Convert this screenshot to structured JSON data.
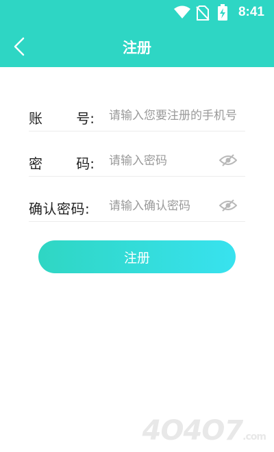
{
  "status_bar": {
    "time": "8:41",
    "icons": [
      "wifi-icon",
      "no-sim-icon",
      "battery-charging-icon"
    ]
  },
  "header": {
    "title": "注册",
    "back_icon": "chevron-left-icon",
    "color": "#2ed6c4"
  },
  "form": {
    "phone": {
      "label_left": "账",
      "label_right": "号:",
      "placeholder": "请输入您要注册的手机号"
    },
    "password": {
      "label_left": "密",
      "label_right": "码:",
      "placeholder": "请输入密码",
      "icon": "eye-off-icon"
    },
    "confirm": {
      "label": "确认密码:",
      "placeholder": "请输入确认密码",
      "icon": "eye-off-icon"
    }
  },
  "submit": {
    "label": "注册",
    "gradient": [
      "#2fd6c3",
      "#38e2ef"
    ]
  },
  "watermark": {
    "text": "4O4O7",
    "suffix": ".com"
  }
}
